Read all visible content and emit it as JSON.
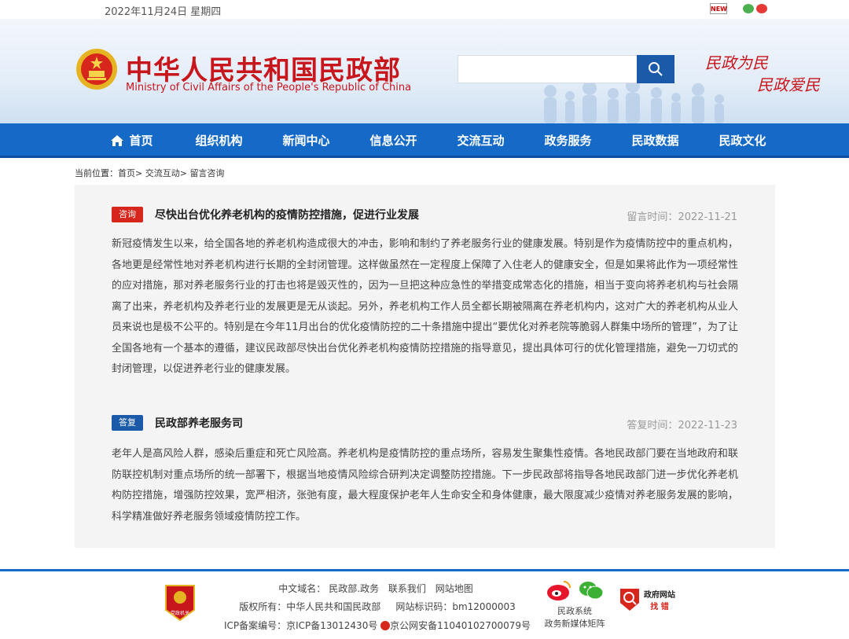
{
  "topbar": {
    "date": "2022年11月24日 星期四",
    "new_icon": "NEW"
  },
  "header": {
    "title_cn": "中华人民共和国民政部",
    "title_en": "Ministry of Civil Affairs of the People's Republic of China",
    "search": {
      "placeholder": "",
      "value": ""
    },
    "slogan_1": "民政为民",
    "slogan_2": "民政爱民"
  },
  "nav": {
    "items": [
      "首页",
      "组织机构",
      "新闻中心",
      "信息公开",
      "交流互动",
      "政务服务",
      "民政数据",
      "民政文化"
    ]
  },
  "breadcrumb": {
    "prefix": "当前位置：",
    "home": "首页",
    "sep": ">",
    "level1": "交流互动",
    "level2": "留言咨询"
  },
  "question": {
    "tag": "咨询",
    "title": "尽快出台优化养老机构的疫情防控措施，促进行业发展",
    "time_label": "留言时间：",
    "time": "2022-11-21",
    "body": "新冠疫情发生以来，给全国各地的养老机构造成很大的冲击，影响和制约了养老服务行业的健康发展。特别是作为疫情防控中的重点机构，各地更是经常性地对养老机构进行长期的全封闭管理。这样做虽然在一定程度上保障了入住老人的健康安全，但是如果将此作为一项经常性的应对措施，那对养老服务行业的打击也将是毁灭性的，因为一旦把这种应急性的举措变成常态化的措施，相当于变向将养老机构与社会隔离了出来，养老机构及养老行业的发展更是无从谈起。另外，养老机构工作人员全都长期被隔离在养老机构内，这对广大的养老机构从业人员来说也是极不公平的。特别是在今年11月出台的优化疫情防控的二十条措施中提出“要优化对养老院等脆弱人群集中场所的管理”，为了让全国各地有一个基本的遵循，建议民政部尽快出台优化养老机构疫情防控措施的指导意见，提出具体可行的优化管理措施，避免一刀切式的封闭管理，以促进养老行业的健康发展。"
  },
  "answer": {
    "tag": "答复",
    "title": "民政部养老服务司",
    "time_label": "答复时间：",
    "time": "2022-11-23",
    "body": "老年人是高风险人群，感染后重症和死亡风险高。养老机构是疫情防控的重点场所，容易发生聚集性疫情。各地民政部门要在当地政府和联防联控机制对重点场所的统一部署下，根据当地疫情风险综合研判决定调整防控措施。下一步民政部将指导各地民政部门进一步优化养老机构防控措施，增强防控效果，宽严相济，张弛有度，最大程度保护老年人生命安全和身体健康，最大限度减少疫情对养老服务发展的影响，科学精准做好养老服务领域疫情防控工作。"
  },
  "footer": {
    "domain_label": "中文域名：",
    "domain": "民政部.政务",
    "contact": "联系我们",
    "sitemap": "网站地图",
    "copyright_label": "版权所有：",
    "copyright": "中华人民共和国民政部",
    "site_id_label": "网站标识码：",
    "site_id": "bm12000003",
    "icp_label": "ICP备案编号：",
    "icp": "京ICP备13012430号",
    "police": "京公网安备11040102700079号",
    "badge_text": "党政机关",
    "social_line1": "民政系统",
    "social_line2": "政务新媒体矩阵",
    "gov_line1": "政府网站",
    "gov_line2": "找 错"
  }
}
